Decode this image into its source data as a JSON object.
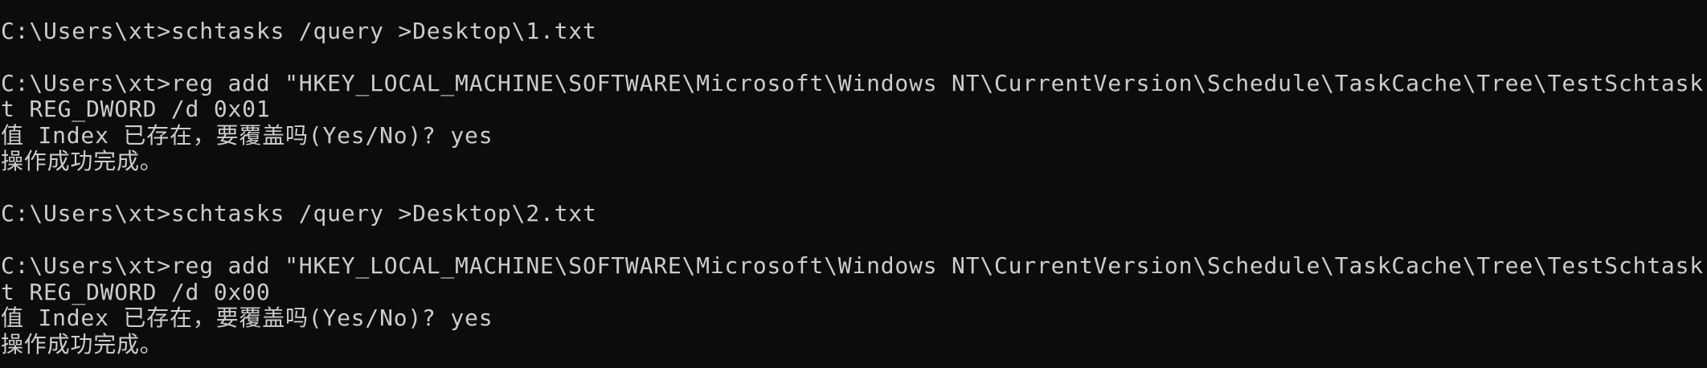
{
  "console": {
    "lines": [
      "",
      "C:\\Users\\xt>schtasks /query >Desktop\\1.txt",
      "",
      "C:\\Users\\xt>reg add \"HKEY_LOCAL_MACHINE\\SOFTWARE\\Microsoft\\Windows NT\\CurrentVersion\\Schedule\\TaskCache\\Tree\\TestSchtask\" /v Index /",
      "t REG_DWORD /d 0x01",
      "值 Index 已存在，要覆盖吗(Yes/No)? yes",
      "操作成功完成。",
      "",
      "C:\\Users\\xt>schtasks /query >Desktop\\2.txt",
      "",
      "C:\\Users\\xt>reg add \"HKEY_LOCAL_MACHINE\\SOFTWARE\\Microsoft\\Windows NT\\CurrentVersion\\Schedule\\TaskCache\\Tree\\TestSchtask\" /v Index /",
      "t REG_DWORD /d 0x00",
      "值 Index 已存在，要覆盖吗(Yes/No)? yes",
      "操作成功完成。"
    ]
  }
}
